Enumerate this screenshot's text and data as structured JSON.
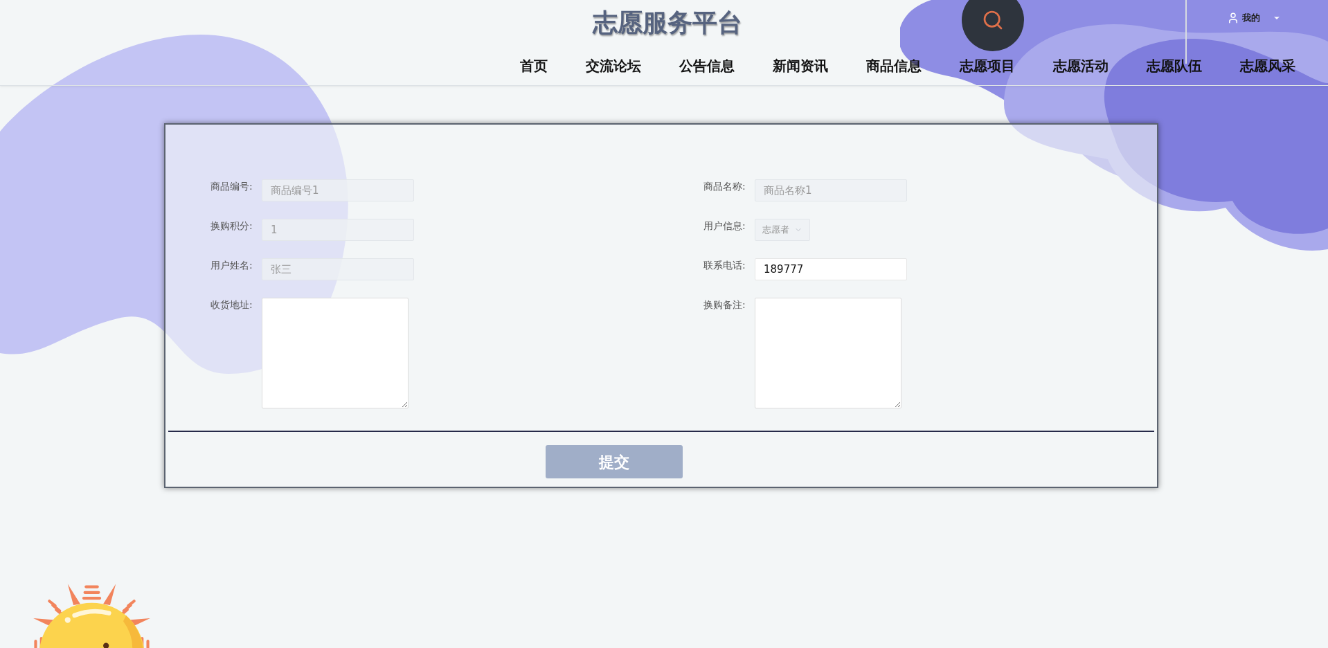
{
  "header": {
    "title": "志愿服务平台",
    "user_menu": "我的",
    "nav": [
      {
        "label": "首页"
      },
      {
        "label": "交流论坛"
      },
      {
        "label": "公告信息"
      },
      {
        "label": "新闻资讯"
      },
      {
        "label": "商品信息"
      },
      {
        "label": "志愿项目"
      },
      {
        "label": "志愿活动"
      },
      {
        "label": "志愿队伍"
      },
      {
        "label": "志愿风采"
      }
    ]
  },
  "form": {
    "fields": [
      {
        "kind": "input",
        "label": "商品编号:",
        "value": "商品编号1",
        "disabled": true
      },
      {
        "kind": "input",
        "label": "商品名称:",
        "value": "商品名称1",
        "disabled": true
      },
      {
        "kind": "input",
        "label": "换购积分:",
        "value": "1",
        "disabled": true
      },
      {
        "kind": "select",
        "label": "用户信息:",
        "value": "志愿者",
        "disabled": true
      },
      {
        "kind": "input",
        "label": "用户姓名:",
        "value": "张三",
        "disabled": true
      },
      {
        "kind": "input",
        "label": "联系电话:",
        "value": "189777",
        "disabled": false
      },
      {
        "kind": "textarea",
        "label": "收货地址:",
        "disabled": false
      },
      {
        "kind": "textarea",
        "label": "换购备注:",
        "disabled": false
      }
    ],
    "submit": "提交"
  }
}
